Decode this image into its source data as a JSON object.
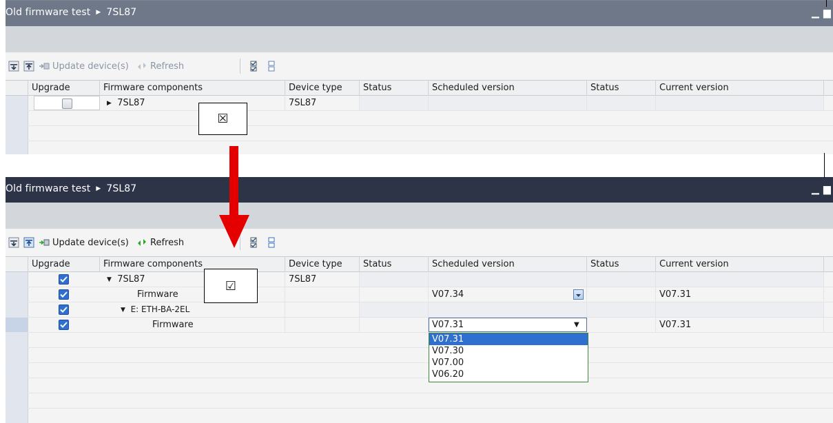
{
  "panel1": {
    "breadcrumb": [
      "Old firmware test",
      "7SL87"
    ],
    "toolbar": {
      "update_label": "Update device(s)",
      "refresh_label": "Refresh"
    },
    "columns": [
      "Upgrade",
      "Firmware components",
      "Device type",
      "Status",
      "Scheduled version",
      "Status",
      "Current version"
    ],
    "rows": [
      {
        "component": "7SL87",
        "device_type": "7SL87",
        "expanded": false,
        "upgrade_checked": false
      }
    ],
    "overlay_symbol": "☒"
  },
  "panel2": {
    "breadcrumb": [
      "Old firmware test",
      "7SL87"
    ],
    "toolbar": {
      "update_label": "Update device(s)",
      "refresh_label": "Refresh"
    },
    "columns": [
      "Upgrade",
      "Firmware components",
      "Device type",
      "Status",
      "Scheduled version",
      "Status",
      "Current version"
    ],
    "rows": [
      {
        "component": "7SL87",
        "device_type": "7SL87",
        "scheduled": "",
        "current": "",
        "expanded": true,
        "upgrade_checked": true
      },
      {
        "component": "Firmware",
        "device_type": "",
        "scheduled": "V07.34",
        "current": "V07.31",
        "upgrade_checked": true
      },
      {
        "component": "E: ETH-BA-2EL",
        "device_type": "",
        "scheduled": "",
        "current": "",
        "expanded": true,
        "upgrade_checked": true
      },
      {
        "component": "Firmware",
        "device_type": "",
        "scheduled": "V07.31",
        "current": "V07.31",
        "upgrade_checked": true
      }
    ],
    "dropdown_options": [
      "V07.31",
      "V07.30",
      "V07.00",
      "V06.20"
    ],
    "dropdown_selected": "V07.31",
    "overlay_symbol": "☑"
  },
  "colors": {
    "title_bg_inactive": "#6e7889",
    "title_bg_active": "#2d3448",
    "arrow": "#e40000",
    "checkbox_on": "#2f6fcf",
    "dropdown_border": "#3a8a3a"
  }
}
